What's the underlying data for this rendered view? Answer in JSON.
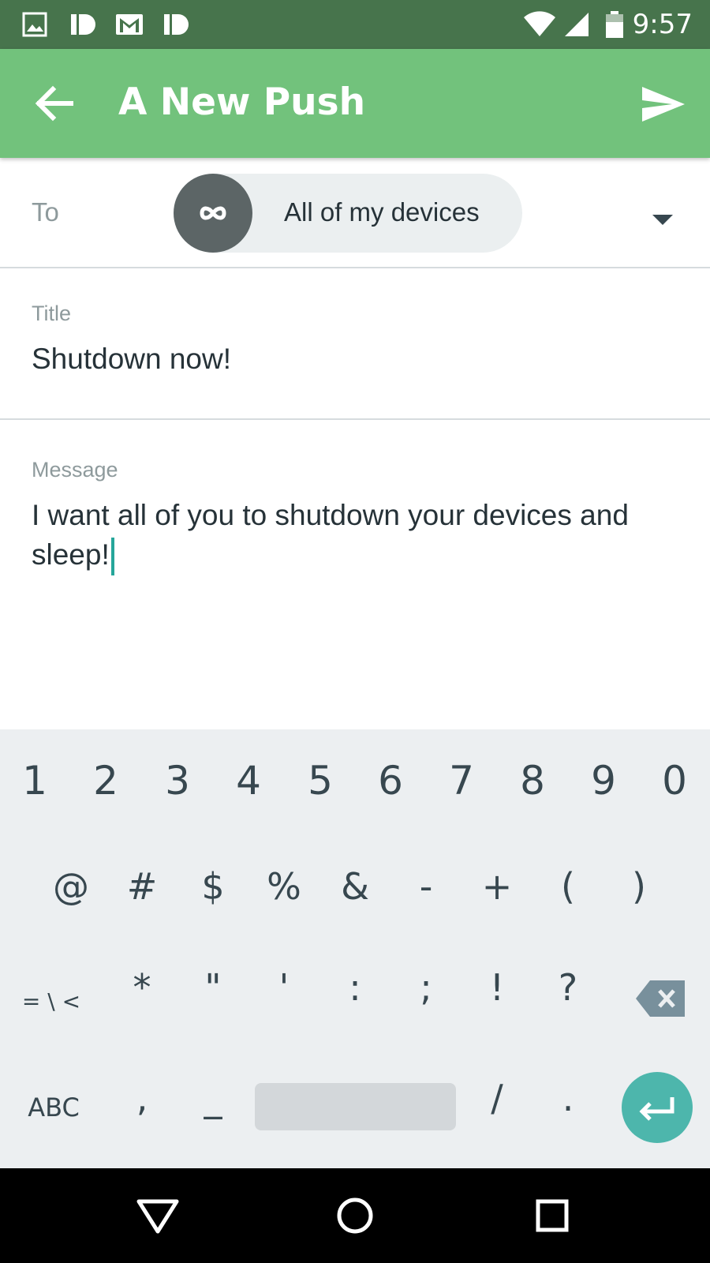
{
  "status_bar": {
    "time": "9:57",
    "icons": [
      "image-icon",
      "pushbullet-icon",
      "gmail-icon",
      "pushbullet-icon",
      "wifi-icon",
      "cell-signal-icon",
      "battery-icon"
    ]
  },
  "app_bar": {
    "title": "A New Push",
    "back_icon": "arrow-back-icon",
    "send_icon": "send-icon",
    "color": "#72c27c"
  },
  "to_row": {
    "label": "To",
    "chip_label": "All of my devices",
    "chip_icon": "infinity-icon"
  },
  "title_field": {
    "label": "Title",
    "value": "Shutdown now!"
  },
  "message_field": {
    "label": "Message",
    "value_line1": "I want all of you to shutdown your devices and",
    "value_line2": "sleep!"
  },
  "keyboard": {
    "numbers": [
      "1",
      "2",
      "3",
      "4",
      "5",
      "6",
      "7",
      "8",
      "9",
      "0"
    ],
    "symbols": [
      "@",
      "#",
      "$",
      "%",
      "&",
      "-",
      "+",
      "(",
      ")"
    ],
    "row3": [
      "= \\ <",
      "*",
      "\"",
      "'",
      ":",
      ";",
      "!",
      "?"
    ],
    "row4": [
      "ABC",
      ",",
      "_",
      "/",
      "."
    ],
    "enter_color": "#4db6ac"
  },
  "nav_bar": {
    "icons": [
      "back-triangle-icon",
      "home-circle-icon",
      "recents-square-icon"
    ]
  }
}
